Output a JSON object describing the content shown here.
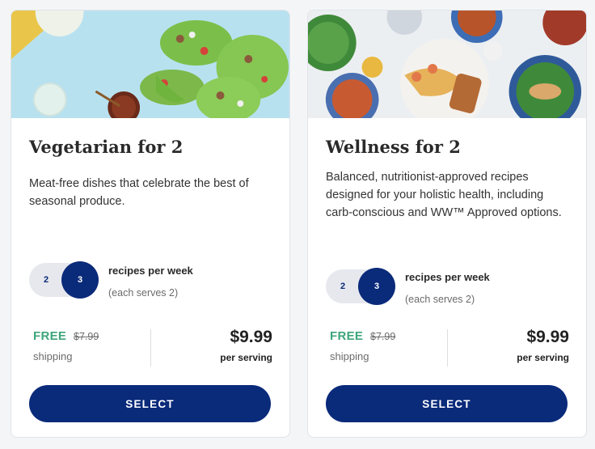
{
  "plans": [
    {
      "title": "Vegetarian for 2",
      "description": "Meat-free dishes that celebrate the best of seasonal produce.",
      "recipe_options": [
        "2",
        "3"
      ],
      "selected_recipes": "3",
      "recipes_label": "recipes per week",
      "serves_label": "(each serves 2)",
      "free_label": "FREE",
      "original_shipping": "$7.99",
      "shipping_label": "shipping",
      "price": "$9.99",
      "price_unit": "per serving",
      "button_label": "SELECT"
    },
    {
      "title": "Wellness for 2",
      "description": "Balanced, nutritionist-approved recipes designed for your holistic health, including carb-conscious and WW™ Approved options.",
      "recipe_options": [
        "2",
        "3"
      ],
      "selected_recipes": "3",
      "recipes_label": "recipes per week",
      "serves_label": "(each serves 2)",
      "free_label": "FREE",
      "original_shipping": "$7.99",
      "shipping_label": "shipping",
      "price": "$9.99",
      "price_unit": "per serving",
      "button_label": "SELECT"
    }
  ],
  "colors": {
    "brand_blue": "#0a2a7a",
    "free_green": "#3da57a"
  }
}
